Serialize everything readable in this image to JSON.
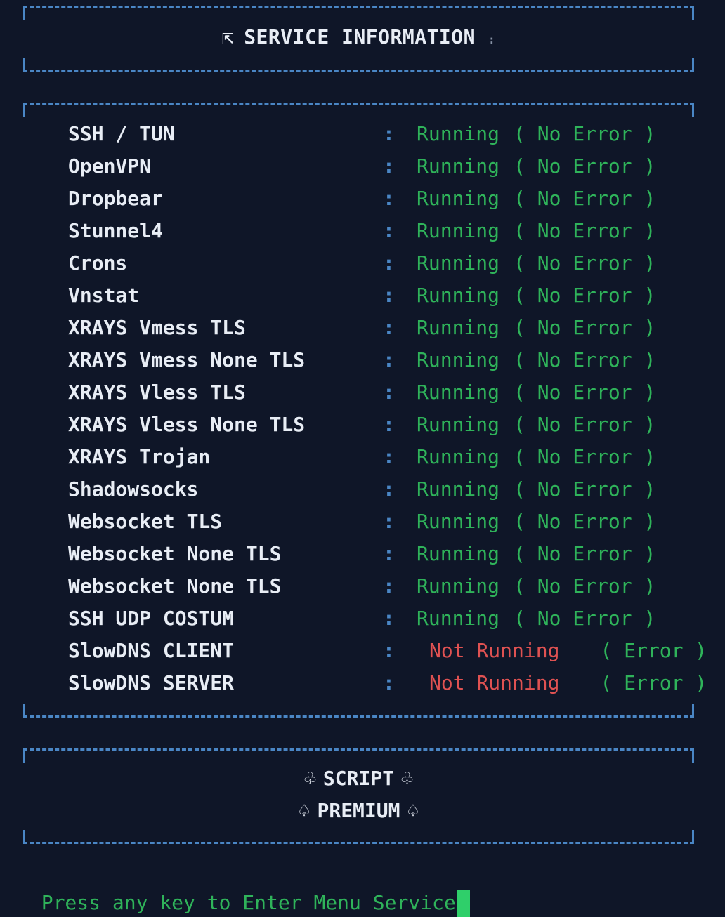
{
  "header": {
    "title": "SERVICE INFORMATION",
    "icon": "corner-arrow-icon",
    "trailing_mark": ":"
  },
  "services": [
    {
      "name": "SSH / TUN",
      "status": "Running",
      "detail": "( No Error )",
      "state": "ok"
    },
    {
      "name": "OpenVPN",
      "status": "Running",
      "detail": "( No Error )",
      "state": "ok"
    },
    {
      "name": "Dropbear",
      "status": "Running",
      "detail": "( No Error )",
      "state": "ok"
    },
    {
      "name": "Stunnel4",
      "status": "Running",
      "detail": "( No Error )",
      "state": "ok"
    },
    {
      "name": "Crons",
      "status": "Running",
      "detail": "( No Error )",
      "state": "ok"
    },
    {
      "name": "Vnstat",
      "status": "Running",
      "detail": "( No Error )",
      "state": "ok"
    },
    {
      "name": "XRAYS Vmess TLS",
      "status": "Running",
      "detail": "( No Error )",
      "state": "ok"
    },
    {
      "name": "XRAYS Vmess None TLS",
      "status": "Running",
      "detail": "( No Error )",
      "state": "ok"
    },
    {
      "name": "XRAYS Vless TLS",
      "status": "Running",
      "detail": "( No Error )",
      "state": "ok"
    },
    {
      "name": "XRAYS Vless None TLS",
      "status": "Running",
      "detail": "( No Error )",
      "state": "ok"
    },
    {
      "name": "XRAYS Trojan",
      "status": "Running",
      "detail": "( No Error )",
      "state": "ok"
    },
    {
      "name": "Shadowsocks",
      "status": "Running",
      "detail": "( No Error )",
      "state": "ok"
    },
    {
      "name": "Websocket TLS",
      "status": "Running",
      "detail": "( No Error )",
      "state": "ok"
    },
    {
      "name": "Websocket None TLS",
      "status": "Running",
      "detail": "( No Error )",
      "state": "ok"
    },
    {
      "name": "Websocket None TLS",
      "status": "Running",
      "detail": "( No Error )",
      "state": "ok"
    },
    {
      "name": "SSH UDP COSTUM",
      "status": "Running",
      "detail": "( No Error )",
      "state": "ok"
    },
    {
      "name": "SlowDNS CLIENT",
      "status": "Not Running",
      "detail": "( Error )",
      "state": "bad"
    },
    {
      "name": "SlowDNS SERVER",
      "status": "Not Running",
      "detail": "( Error )",
      "state": "bad"
    }
  ],
  "separator": ":",
  "footer": {
    "line1": "SCRIPT",
    "line1_icon": "club-icon",
    "line2": "PREMIUM",
    "line2_icon": "spade-icon"
  },
  "prompt": {
    "text": "Press any key to Enter Menu Service"
  },
  "colors": {
    "background": "#0f1628",
    "border": "#4a86c5",
    "ok": "#2fb35a",
    "error": "#e05252",
    "text": "#e8edf5"
  }
}
